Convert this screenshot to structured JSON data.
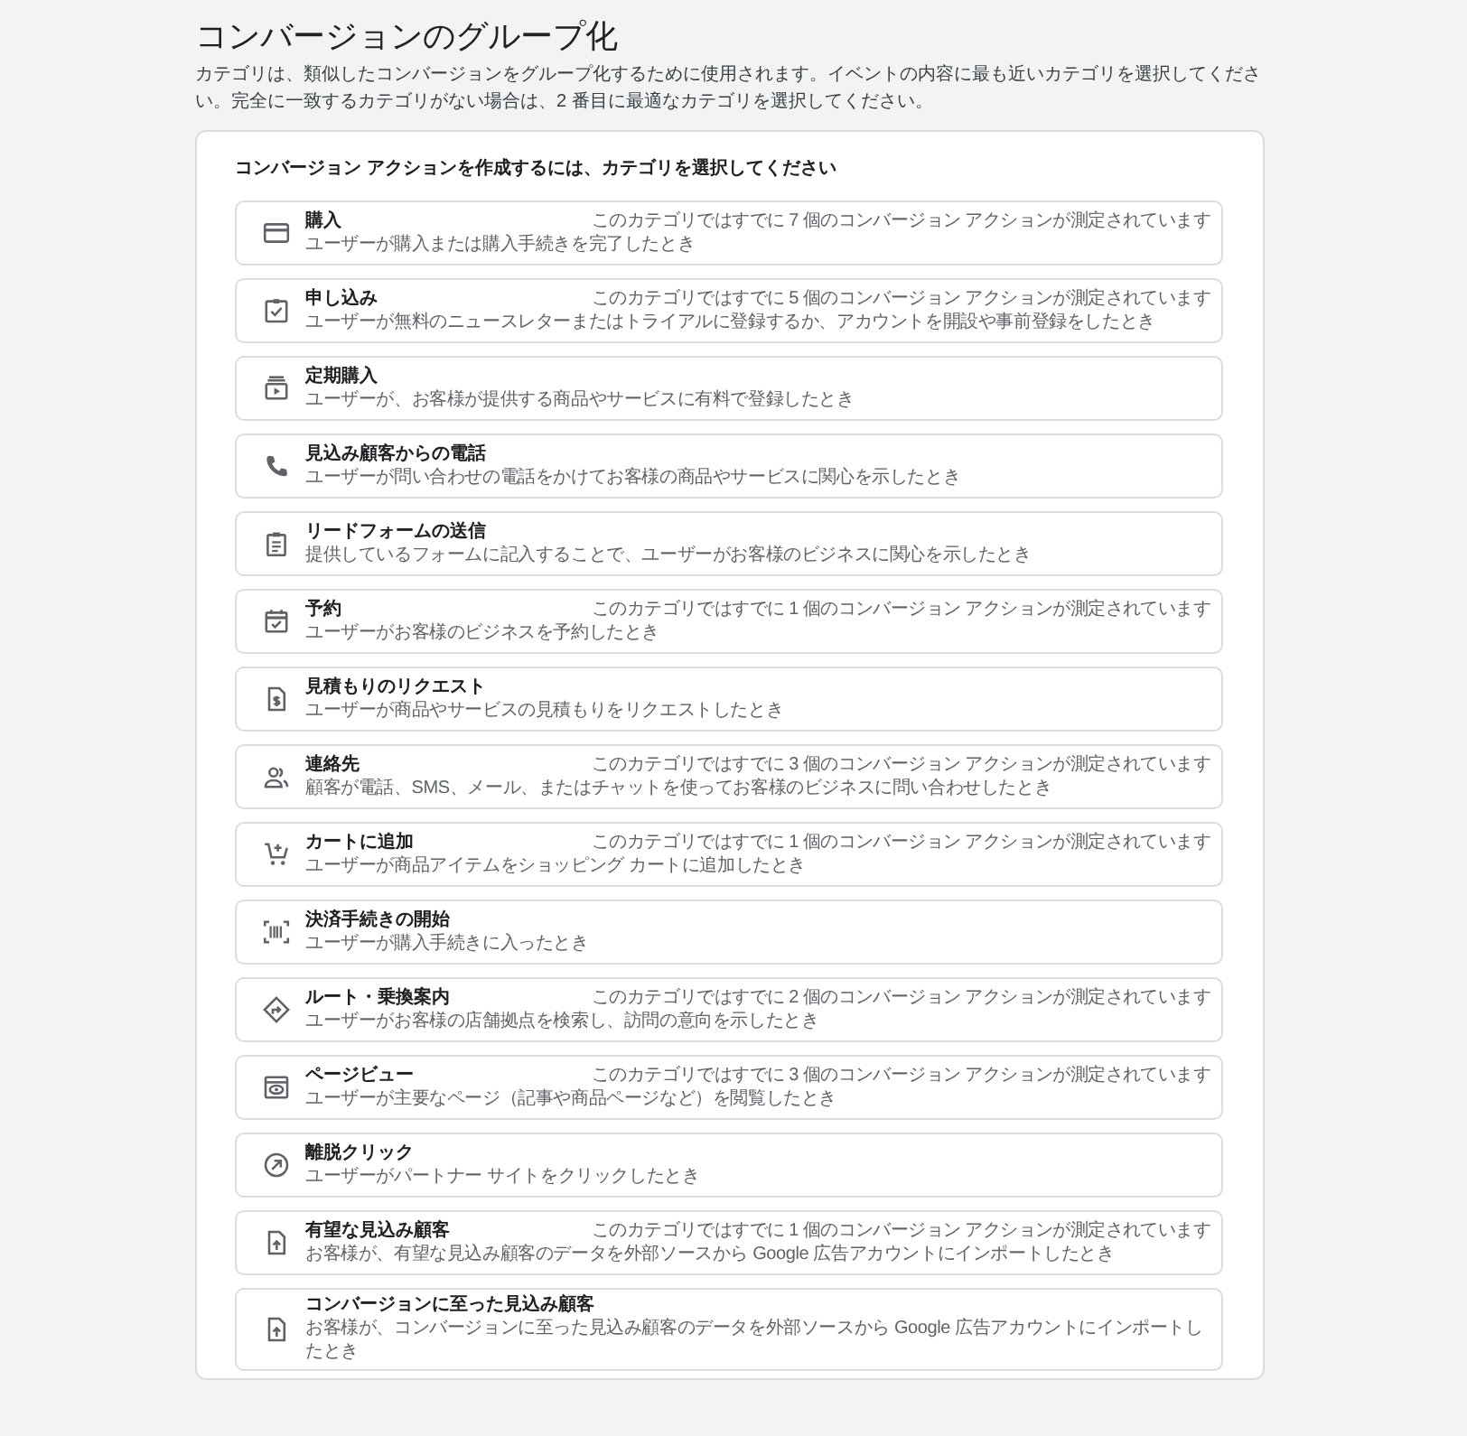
{
  "title": "コンバージョンのグループ化",
  "description": "カテゴリは、類似したコンバージョンをグループ化するために使用されます。イベントの内容に最も近いカテゴリを選択してください。完全に一致するカテゴリがない場合は、2 番目に最適なカテゴリを選択してください。",
  "card": {
    "heading": "コンバージョン アクションを作成するには、カテゴリを選択してください",
    "categories": [
      {
        "title": "購入",
        "description": "ユーザーが購入または購入手続きを完了したとき",
        "count_note": "このカテゴリではすでに 7 個のコンバージョン アクションが測定されています"
      },
      {
        "title": "申し込み",
        "description": "ユーザーが無料のニュースレターまたはトライアルに登録するか、アカウントを開設や事前登録をしたとき",
        "count_note": "このカテゴリではすでに 5 個のコンバージョン アクションが測定されています"
      },
      {
        "title": "定期購入",
        "description": "ユーザーが、お客様が提供する商品やサービスに有料で登録したとき"
      },
      {
        "title": "見込み顧客からの電話",
        "description": "ユーザーが問い合わせの電話をかけてお客様の商品やサービスに関心を示したとき"
      },
      {
        "title": "リードフォームの送信",
        "description": "提供しているフォームに記入することで、ユーザーがお客様のビジネスに関心を示したとき"
      },
      {
        "title": "予約",
        "description": "ユーザーがお客様のビジネスを予約したとき",
        "count_note": "このカテゴリではすでに 1 個のコンバージョン アクションが測定されています"
      },
      {
        "title": "見積もりのリクエスト",
        "description": "ユーザーが商品やサービスの見積もりをリクエストしたとき"
      },
      {
        "title": "連絡先",
        "description": "顧客が電話、SMS、メール、またはチャットを使ってお客様のビジネスに問い合わせしたとき",
        "count_note": "このカテゴリではすでに 3 個のコンバージョン アクションが測定されています"
      },
      {
        "title": "カートに追加",
        "description": "ユーザーが商品アイテムをショッピング カートに追加したとき",
        "count_note": "このカテゴリではすでに 1 個のコンバージョン アクションが測定されています"
      },
      {
        "title": "決済手続きの開始",
        "description": "ユーザーが購入手続きに入ったとき"
      },
      {
        "title": "ルート・乗換案内",
        "description": "ユーザーがお客様の店舗拠点を検索し、訪問の意向を示したとき",
        "count_note": "このカテゴリではすでに 2 個のコンバージョン アクションが測定されています"
      },
      {
        "title": "ページビュー",
        "description": "ユーザーが主要なページ（記事や商品ページなど）を閲覧したとき",
        "count_note": "このカテゴリではすでに 3 個のコンバージョン アクションが測定されています"
      },
      {
        "title": "離脱クリック",
        "description": "ユーザーがパートナー サイトをクリックしたとき"
      },
      {
        "title": "有望な見込み顧客",
        "description": "お客様が、有望な見込み顧客のデータを外部ソースから Google 広告アカウントにインポートしたとき",
        "count_note": "このカテゴリではすでに 1 個のコンバージョン アクションが測定されています"
      },
      {
        "title": "コンバージョンに至った見込み顧客",
        "description": "お客様が、コンバージョンに至った見込み顧客のデータを外部ソースから Google 広告アカウントにインポートしたとき"
      }
    ]
  }
}
